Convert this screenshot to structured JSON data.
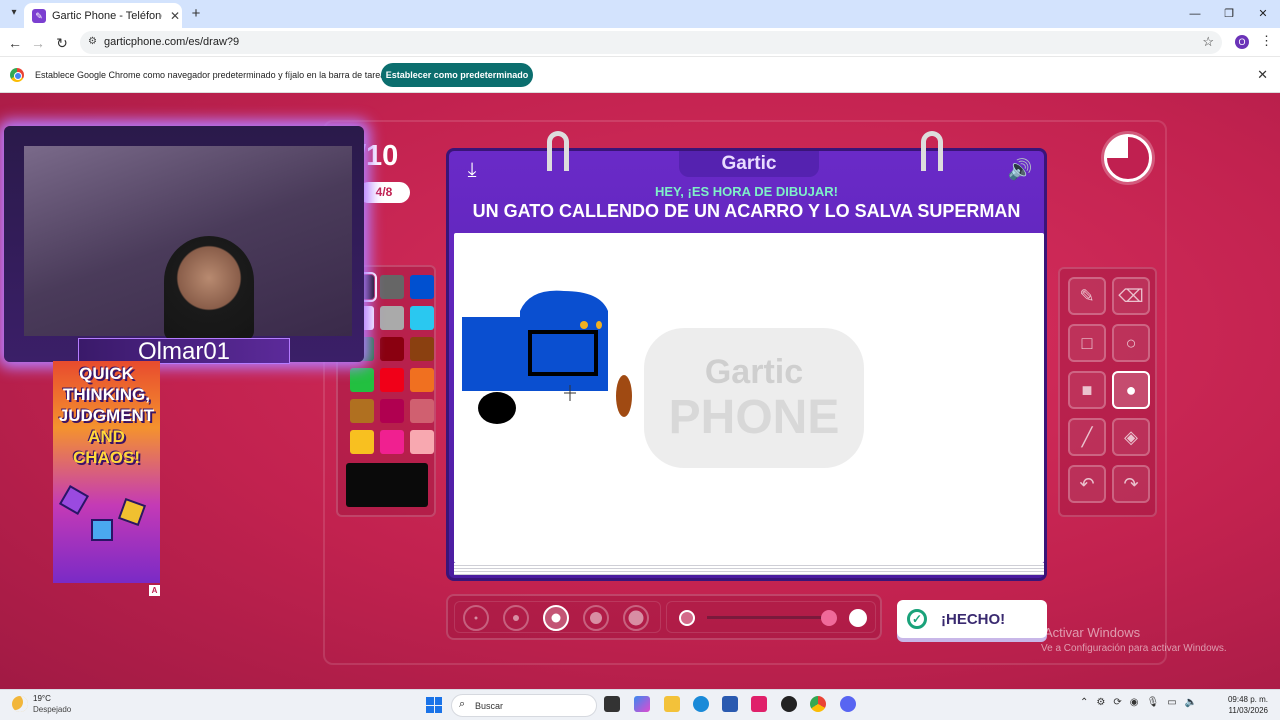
{
  "browser": {
    "tab_title": "Gartic Phone - Teléfono Descon",
    "url": "garticphone.com/es/draw?9",
    "profile_initial": "O",
    "infobar_text": "Establece Google Chrome como navegador predeterminado y fíjalo en la barra de tareas",
    "infobar_button": "Establecer como predeterminado"
  },
  "game": {
    "round_big": "/10",
    "round_pill": "4/8",
    "logo": "Gartic",
    "prompt_title": "HEY, ¡ES HORA DE DIBUJAR!",
    "prompt_text": "UN GATO CALLENDO DE UN ACARRO Y LO SALVA SUPERMAN",
    "watermark_line1": "Gartic",
    "watermark_line2": "PHONE",
    "done_button": "¡HECHO!",
    "palette": [
      "#000000",
      "#666666",
      "#0050d0",
      "#ffffff",
      "#aaaaaa",
      "#2ac8f0",
      "#1a7a30",
      "#8a0010",
      "#8a4010",
      "#22c040",
      "#f00018",
      "#f07020",
      "#b07020",
      "#b00050",
      "#d06070",
      "#f8c020",
      "#f02090",
      "#f8a8b0"
    ],
    "selected_color": "#0a0a0a",
    "tools": [
      "pencil-icon",
      "eraser-icon",
      "rect-outline-icon",
      "circle-outline-icon",
      "rect-fill-icon",
      "circle-fill-icon",
      "line-icon",
      "bucket-icon",
      "undo-icon",
      "redo-icon"
    ],
    "active_tool": "circle-fill-icon",
    "brush_sizes": 5,
    "active_brush": 3,
    "opacity_level": 0.88,
    "timer_remaining": 0.75
  },
  "overlay": {
    "streamer_name": "Olmar01",
    "ad_line1": "QUICK",
    "ad_line2": "THINKING,",
    "ad_line3": "JUDGMENT",
    "ad_line4": "AND",
    "ad_line5": "CHAOS!",
    "ad_badge": "A"
  },
  "windows": {
    "activate_title": "Activar Windows",
    "activate_sub": "Ve a Configuración para activar Windows.",
    "weather_temp": "19°C",
    "weather_desc": "Despejado",
    "search_label": "Buscar",
    "clock_time": "09:48 p. m.",
    "clock_date": "11/03/2026"
  }
}
